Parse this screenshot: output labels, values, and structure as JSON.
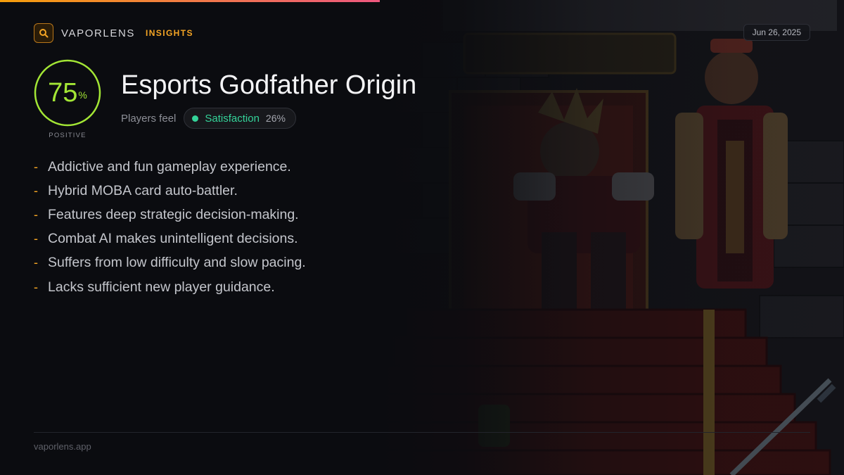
{
  "brand": {
    "name": "VAPORLENS",
    "tag": "INSIGHTS",
    "icon": "search-icon",
    "accent": "#f5a524"
  },
  "date": "Jun 26, 2025",
  "score": {
    "value": "75",
    "unit": "%",
    "fraction": 0.75,
    "label": "POSITIVE",
    "color": "#a3e635"
  },
  "game": {
    "title": "Esports Godfather Origin"
  },
  "feel": {
    "label": "Players feel",
    "sentiment": "Satisfaction",
    "percent": "26%",
    "color": "#34d399"
  },
  "points": [
    "Addictive and fun gameplay experience.",
    "Hybrid MOBA card auto-battler.",
    "Features deep strategic decision-making.",
    "Combat AI makes unintelligent decisions.",
    "Suffers from low difficulty and slow pacing.",
    "Lacks sufficient new player guidance."
  ],
  "footer": "vaporlens.app"
}
